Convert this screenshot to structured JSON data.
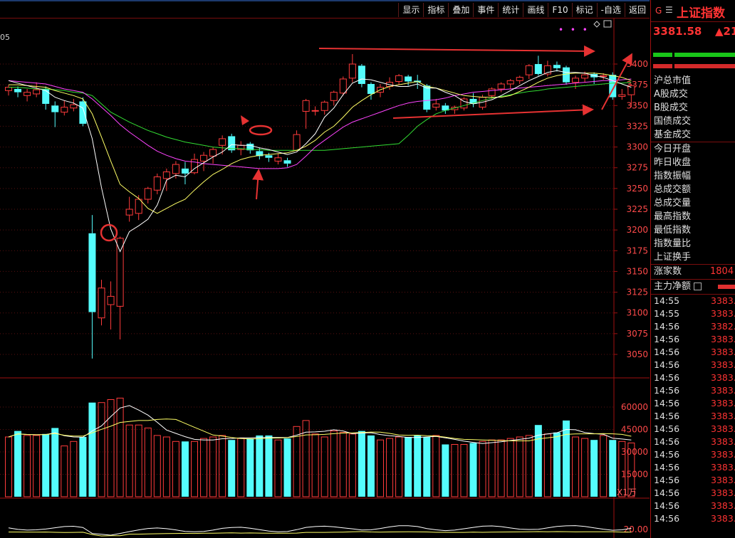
{
  "toolbar": {
    "items": [
      "显示",
      "指标",
      "叠加",
      "事件",
      "统计",
      "画线",
      "F10",
      "标记",
      "-自选",
      "返回"
    ]
  },
  "chart_left_label": "05",
  "xunit": "X1万",
  "right_panel": {
    "flag": "G",
    "menu": "☰",
    "name": "上证指数",
    "price": "3381.58",
    "change": "▲21",
    "labels": [
      "沪总市值",
      "A股成交",
      "B股成交",
      "国债成交",
      "基金成交",
      "今日开盘",
      "昨日收盘",
      "指数振幅",
      "总成交额",
      "总成交量",
      "最高指数",
      "最低指数",
      "指数量比",
      "上证换手"
    ],
    "up_count_label": "涨家数",
    "up_count": "1804",
    "main_net_label": "主力净额",
    "ticks": [
      {
        "t": "14:55",
        "p": "3383."
      },
      {
        "t": "14:55",
        "p": "3383."
      },
      {
        "t": "14:56",
        "p": "3382."
      },
      {
        "t": "14:56",
        "p": "3383."
      },
      {
        "t": "14:56",
        "p": "3383."
      },
      {
        "t": "14:56",
        "p": "3383."
      },
      {
        "t": "14:56",
        "p": "3383."
      },
      {
        "t": "14:56",
        "p": "3383."
      },
      {
        "t": "14:56",
        "p": "3383."
      },
      {
        "t": "14:56",
        "p": "3383."
      },
      {
        "t": "14:56",
        "p": "3383."
      },
      {
        "t": "14:56",
        "p": "3383."
      },
      {
        "t": "14:56",
        "p": "3383."
      },
      {
        "t": "14:56",
        "p": "3383."
      },
      {
        "t": "14:56",
        "p": "3383."
      },
      {
        "t": "14:56",
        "p": "3383."
      },
      {
        "t": "14:56",
        "p": "3383."
      },
      {
        "t": "14:56",
        "p": "3383."
      }
    ]
  },
  "colors": {
    "up": "#ff3b3b",
    "down": "#54fcfc",
    "ma5": "#ffffff",
    "ma10": "#ffff66",
    "ma20": "#ff44ff",
    "ma60": "#33dd33",
    "annot": "#e63232"
  },
  "chart_data": {
    "type": "candlestick",
    "price_ticks": [
      3400,
      3375,
      3350,
      3325,
      3300,
      3275,
      3250,
      3225,
      3200,
      3175,
      3150,
      3125,
      3100,
      3075,
      3050
    ],
    "volume_ticks": [
      60000,
      45000,
      30000,
      15000
    ],
    "osc_tick": "20.00",
    "candles": [
      {
        "o": 3368,
        "c": 3372,
        "h": 3375,
        "l": 3362
      },
      {
        "o": 3370,
        "c": 3366,
        "h": 3373,
        "l": 3360
      },
      {
        "o": 3362,
        "c": 3366,
        "h": 3370,
        "l": 3355
      },
      {
        "o": 3364,
        "c": 3369,
        "h": 3378,
        "l": 3360
      },
      {
        "o": 3370,
        "c": 3352,
        "h": 3373,
        "l": 3345
      },
      {
        "o": 3350,
        "c": 3342,
        "h": 3355,
        "l": 3324
      },
      {
        "o": 3342,
        "c": 3348,
        "h": 3356,
        "l": 3338
      },
      {
        "o": 3347,
        "c": 3351,
        "h": 3358,
        "l": 3343
      },
      {
        "o": 3355,
        "c": 3328,
        "h": 3360,
        "l": 3325
      },
      {
        "o": 3196,
        "c": 3101,
        "h": 3218,
        "l": 3045
      },
      {
        "o": 3094,
        "c": 3130,
        "h": 3140,
        "l": 3085
      },
      {
        "o": 3110,
        "c": 3120,
        "h": 3138,
        "l": 3080
      },
      {
        "o": 3108,
        "c": 3190,
        "h": 3192,
        "l": 3068
      },
      {
        "o": 3218,
        "c": 3225,
        "h": 3240,
        "l": 3210
      },
      {
        "o": 3220,
        "c": 3237,
        "h": 3242,
        "l": 3212
      },
      {
        "o": 3237,
        "c": 3250,
        "h": 3252,
        "l": 3232
      },
      {
        "o": 3248,
        "c": 3264,
        "h": 3268,
        "l": 3243
      },
      {
        "o": 3262,
        "c": 3270,
        "h": 3274,
        "l": 3247
      },
      {
        "o": 3268,
        "c": 3279,
        "h": 3283,
        "l": 3262
      },
      {
        "o": 3274,
        "c": 3268,
        "h": 3282,
        "l": 3255
      },
      {
        "o": 3269,
        "c": 3285,
        "h": 3292,
        "l": 3267
      },
      {
        "o": 3283,
        "c": 3290,
        "h": 3294,
        "l": 3271
      },
      {
        "o": 3289,
        "c": 3297,
        "h": 3300,
        "l": 3280
      },
      {
        "o": 3302,
        "c": 3310,
        "h": 3314,
        "l": 3291
      },
      {
        "o": 3313,
        "c": 3296,
        "h": 3316,
        "l": 3293
      },
      {
        "o": 3297,
        "c": 3302,
        "h": 3307,
        "l": 3290
      },
      {
        "o": 3304,
        "c": 3296,
        "h": 3306,
        "l": 3292
      },
      {
        "o": 3295,
        "c": 3289,
        "h": 3299,
        "l": 3285
      },
      {
        "o": 3290,
        "c": 3287,
        "h": 3293,
        "l": 3282
      },
      {
        "o": 3283,
        "c": 3287,
        "h": 3292,
        "l": 3279
      },
      {
        "o": 3284,
        "c": 3280,
        "h": 3287,
        "l": 3276
      },
      {
        "o": 3296,
        "c": 3315,
        "h": 3320,
        "l": 3295
      },
      {
        "o": 3343,
        "c": 3356,
        "h": 3358,
        "l": 3322
      },
      {
        "o": 3344,
        "c": 3344,
        "h": 3349,
        "l": 3338
      },
      {
        "o": 3344,
        "c": 3354,
        "h": 3356,
        "l": 3339
      },
      {
        "o": 3356,
        "c": 3366,
        "h": 3368,
        "l": 3350
      },
      {
        "o": 3365,
        "c": 3382,
        "h": 3385,
        "l": 3362
      },
      {
        "o": 3383,
        "c": 3400,
        "h": 3412,
        "l": 3378
      },
      {
        "o": 3398,
        "c": 3376,
        "h": 3400,
        "l": 3372
      },
      {
        "o": 3376,
        "c": 3364,
        "h": 3378,
        "l": 3357
      },
      {
        "o": 3366,
        "c": 3372,
        "h": 3376,
        "l": 3360
      },
      {
        "o": 3373,
        "c": 3378,
        "h": 3384,
        "l": 3369
      },
      {
        "o": 3379,
        "c": 3386,
        "h": 3388,
        "l": 3375
      },
      {
        "o": 3385,
        "c": 3379,
        "h": 3387,
        "l": 3374
      },
      {
        "o": 3380,
        "c": 3378,
        "h": 3387,
        "l": 3370
      },
      {
        "o": 3374,
        "c": 3345,
        "h": 3376,
        "l": 3342
      },
      {
        "o": 3348,
        "c": 3352,
        "h": 3358,
        "l": 3344
      },
      {
        "o": 3350,
        "c": 3344,
        "h": 3353,
        "l": 3340
      },
      {
        "o": 3345,
        "c": 3348,
        "h": 3350,
        "l": 3340
      },
      {
        "o": 3347,
        "c": 3358,
        "h": 3360,
        "l": 3344
      },
      {
        "o": 3358,
        "c": 3352,
        "h": 3365,
        "l": 3348
      },
      {
        "o": 3348,
        "c": 3360,
        "h": 3363,
        "l": 3345
      },
      {
        "o": 3362,
        "c": 3370,
        "h": 3372,
        "l": 3358
      },
      {
        "o": 3370,
        "c": 3376,
        "h": 3378,
        "l": 3366
      },
      {
        "o": 3376,
        "c": 3380,
        "h": 3382,
        "l": 3370
      },
      {
        "o": 3380,
        "c": 3384,
        "h": 3386,
        "l": 3376
      },
      {
        "o": 3387,
        "c": 3398,
        "h": 3400,
        "l": 3382
      },
      {
        "o": 3400,
        "c": 3388,
        "h": 3410,
        "l": 3386
      },
      {
        "o": 3388,
        "c": 3398,
        "h": 3404,
        "l": 3385
      },
      {
        "o": 3399,
        "c": 3395,
        "h": 3403,
        "l": 3391
      },
      {
        "o": 3396,
        "c": 3378,
        "h": 3398,
        "l": 3375
      },
      {
        "o": 3378,
        "c": 3383,
        "h": 3386,
        "l": 3370
      },
      {
        "o": 3383,
        "c": 3387,
        "h": 3391,
        "l": 3378
      },
      {
        "o": 3388,
        "c": 3384,
        "h": 3390,
        "l": 3376
      },
      {
        "o": 3385,
        "c": 3386,
        "h": 3389,
        "l": 3381
      },
      {
        "o": 3387,
        "c": 3360,
        "h": 3390,
        "l": 3357
      },
      {
        "o": 3361,
        "c": 3363,
        "h": 3370,
        "l": 3357
      },
      {
        "o": 3363,
        "c": 3374,
        "h": 3376,
        "l": 3348
      }
    ],
    "volumes": [
      40000,
      44000,
      41000,
      41000,
      42000,
      46000,
      34000,
      37000,
      40000,
      63000,
      63000,
      65000,
      66000,
      48000,
      48000,
      46000,
      41000,
      40000,
      37000,
      37000,
      37000,
      39000,
      40000,
      41000,
      38000,
      39000,
      39000,
      41000,
      41000,
      38000,
      39000,
      47000,
      51000,
      42000,
      40000,
      44000,
      43000,
      42000,
      44000,
      41000,
      38000,
      39000,
      40000,
      40000,
      41000,
      40000,
      41000,
      35000,
      35000,
      35000,
      36000,
      37000,
      38000,
      38000,
      39000,
      40000,
      41000,
      48000,
      42000,
      43000,
      51000,
      40000,
      39000,
      38000,
      41000,
      38000,
      37000,
      36000
    ],
    "ma5": [
      3380,
      3377,
      3374,
      3371,
      3368,
      3360,
      3356,
      3353,
      3347,
      3310,
      3251,
      3201,
      3174,
      3198,
      3205,
      3213,
      3230,
      3260,
      3266,
      3264,
      3274,
      3281,
      3288,
      3294,
      3303,
      3302,
      3302,
      3299,
      3297,
      3294,
      3291,
      3294,
      3304,
      3316,
      3336,
      3347,
      3363,
      3377,
      3382,
      3381,
      3378,
      3375,
      3373,
      3373,
      3376,
      3371,
      3371,
      3366,
      3362,
      3355,
      3352,
      3354,
      3357,
      3362,
      3368,
      3374,
      3380,
      3385,
      3390,
      3392,
      3390,
      3390,
      3389,
      3386,
      3384,
      3380,
      3376,
      3372
    ],
    "ma10": [
      3375,
      3375,
      3374,
      3373,
      3372,
      3368,
      3365,
      3362,
      3358,
      3340,
      3312,
      3283,
      3255,
      3246,
      3238,
      3226,
      3220,
      3226,
      3232,
      3237,
      3248,
      3258,
      3267,
      3273,
      3280,
      3285,
      3288,
      3290,
      3291,
      3292,
      3293,
      3296,
      3301,
      3308,
      3318,
      3325,
      3336,
      3348,
      3356,
      3363,
      3369,
      3373,
      3375,
      3377,
      3379,
      3373,
      3371,
      3368,
      3365,
      3362,
      3361,
      3360,
      3360,
      3360,
      3362,
      3367,
      3372,
      3378,
      3383,
      3386,
      3388,
      3389,
      3389,
      3389,
      3388,
      3386,
      3384,
      3380
    ],
    "ma20": [
      3380,
      3379,
      3378,
      3377,
      3376,
      3373,
      3370,
      3368,
      3366,
      3358,
      3348,
      3338,
      3327,
      3318,
      3310,
      3302,
      3295,
      3290,
      3286,
      3283,
      3282,
      3280,
      3279,
      3278,
      3277,
      3276,
      3275,
      3274,
      3274,
      3274,
      3275,
      3279,
      3289,
      3300,
      3308,
      3316,
      3324,
      3330,
      3334,
      3338,
      3342,
      3346,
      3350,
      3353,
      3355,
      3356,
      3357,
      3359,
      3362,
      3364,
      3366,
      3367,
      3368,
      3369,
      3370,
      3371,
      3372,
      3373,
      3374,
      3375,
      3376,
      3377,
      3378,
      3379,
      3380,
      3380,
      3381,
      3382
    ],
    "ma60": [
      3372,
      3372,
      3371,
      3370,
      3370,
      3369,
      3368,
      3366,
      3365,
      3362,
      3352,
      3342,
      3336,
      3330,
      3325,
      3320,
      3316,
      3312,
      3309,
      3306,
      3304,
      3302,
      3300,
      3299,
      3298,
      3298,
      3297,
      3297,
      3296,
      3296,
      3296,
      3296,
      3296,
      3296,
      3296,
      3297,
      3298,
      3299,
      3300,
      3301,
      3302,
      3303,
      3304,
      3314,
      3325,
      3333,
      3340,
      3344,
      3347,
      3350,
      3353,
      3356,
      3359,
      3361,
      3363,
      3365,
      3367,
      3368,
      3370,
      3371,
      3372,
      3373,
      3374,
      3375,
      3376,
      3377,
      3377,
      3378
    ]
  }
}
